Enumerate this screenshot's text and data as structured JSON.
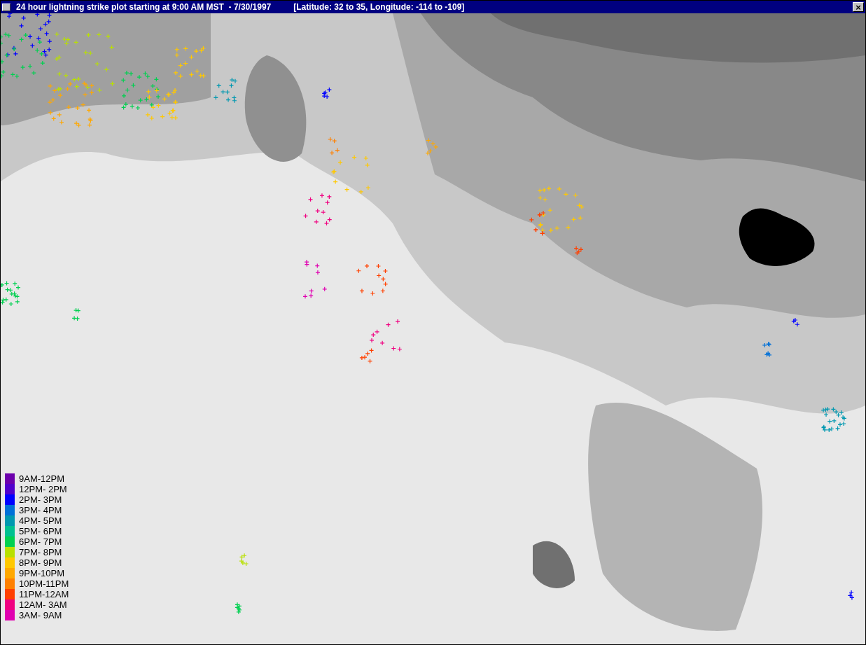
{
  "window": {
    "title": "24 hour lightning strike plot starting at 9:00 AM MST  - 7/30/1997",
    "subtitle": "[Latitude: 32 to 35, Longitude: -114 to -109]",
    "close": "×"
  },
  "legend": [
    {
      "label": "9AM-12PM",
      "color": "#6c00ac"
    },
    {
      "label": "12PM- 2PM",
      "color": "#5000cc"
    },
    {
      "label": "2PM- 3PM",
      "color": "#0000ff"
    },
    {
      "label": "3PM- 4PM",
      "color": "#0070d8"
    },
    {
      "label": "4PM- 5PM",
      "color": "#0098b0"
    },
    {
      "label": "5PM- 6PM",
      "color": "#00c090"
    },
    {
      "label": "6PM- 7PM",
      "color": "#00d050"
    },
    {
      "label": "7PM- 8PM",
      "color": "#b8e000"
    },
    {
      "label": "8PM- 9PM",
      "color": "#ffc800"
    },
    {
      "label": "9PM-10PM",
      "color": "#ffa800"
    },
    {
      "label": "10PM-11PM",
      "color": "#ff8000"
    },
    {
      "label": "11PM-12AM",
      "color": "#ff4000"
    },
    {
      "label": "12AM- 3AM",
      "color": "#f00080"
    },
    {
      "label": "3AM- 9AM",
      "color": "#e000b0"
    }
  ]
}
